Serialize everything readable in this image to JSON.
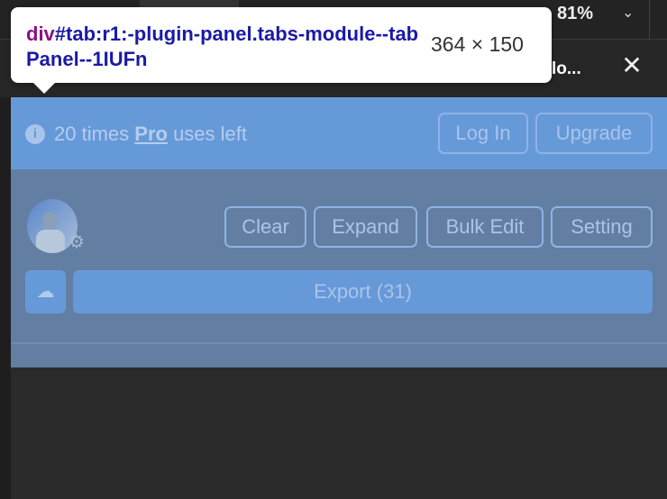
{
  "topbar": {
    "zoom": "81%",
    "chevron_icon": "chevron-down-icon"
  },
  "header": {
    "title": "lo...",
    "close_icon": "close-icon"
  },
  "tooltip": {
    "tag": "div",
    "selector": "#tab:r1:-plugin-panel.tabs-module--tabPanel--1IUFn",
    "size": "364 × 150"
  },
  "pro_bar": {
    "prefix": "20 times ",
    "pro": "Pro",
    "suffix": " uses left",
    "login": "Log In",
    "upgrade": "Upgrade",
    "info_icon": "info-icon"
  },
  "toolbar": {
    "clear": "Clear",
    "expand": "Expand",
    "bulk_edit": "Bulk Edit",
    "setting": "Setting"
  },
  "export": {
    "label": "Export (31)",
    "upload_icon": "cloud-upload-icon"
  },
  "colors": {
    "accent": "#6699d8",
    "overlay": "#627ea2"
  }
}
